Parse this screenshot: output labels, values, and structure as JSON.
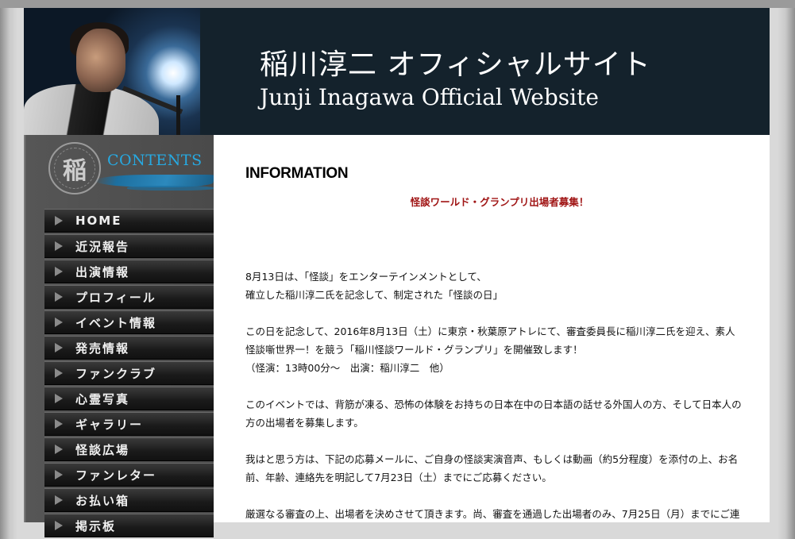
{
  "header": {
    "title_ja": "稲川淳二 オフィシャルサイト",
    "title_en": "Junji Inagawa Official Website"
  },
  "sidebar": {
    "seal_char": "稲",
    "contents_label": "CONTENTS",
    "items": [
      {
        "label": "HOME"
      },
      {
        "label": "近況報告"
      },
      {
        "label": "出演情報"
      },
      {
        "label": "プロフィール"
      },
      {
        "label": "イベント情報"
      },
      {
        "label": "発売情報"
      },
      {
        "label": "ファンクラブ"
      },
      {
        "label": "心霊写真"
      },
      {
        "label": "ギャラリー"
      },
      {
        "label": "怪談広場"
      },
      {
        "label": "ファンレター"
      },
      {
        "label": "お払い箱"
      },
      {
        "label": "掲示板"
      }
    ]
  },
  "main": {
    "heading": "INFORMATION",
    "headline": "怪談ワールド・グランプリ出場者募集！",
    "lines": [
      "8月13日は、「怪談」をエンターテインメントとして、",
      "確立した稲川淳二氏を記念して、制定された「怪談の日」",
      "この日を記念して、2016年8月13日（土）に東京・秋葉原アトレにて、審査委員長に稲川淳二氏を迎え、素人",
      "怪談噺世界一！を競う「稲川怪談ワールド・グランプリ」を開催致します！",
      "（怪演：13時00分〜　出演：稲川淳二　他）",
      "このイベントでは、背筋が凍る、恐怖の体験をお持ちの日本在中の日本語の話せる外国人の方、そして日本人の",
      "方の出場者を募集します。",
      "我はと思う方は、下記の応募メールに、ご自身の怪談実演音声、もしくは動画（約5分程度）を添付の上、お名",
      "前、年齢、連絡先を明記して7月23日（土）までにご応募ください。",
      "厳選なる審査の上、出場者を決めさせて頂きます。尚、審査を通過した出場者のみ、7月25日（月）までにご連"
    ]
  }
}
